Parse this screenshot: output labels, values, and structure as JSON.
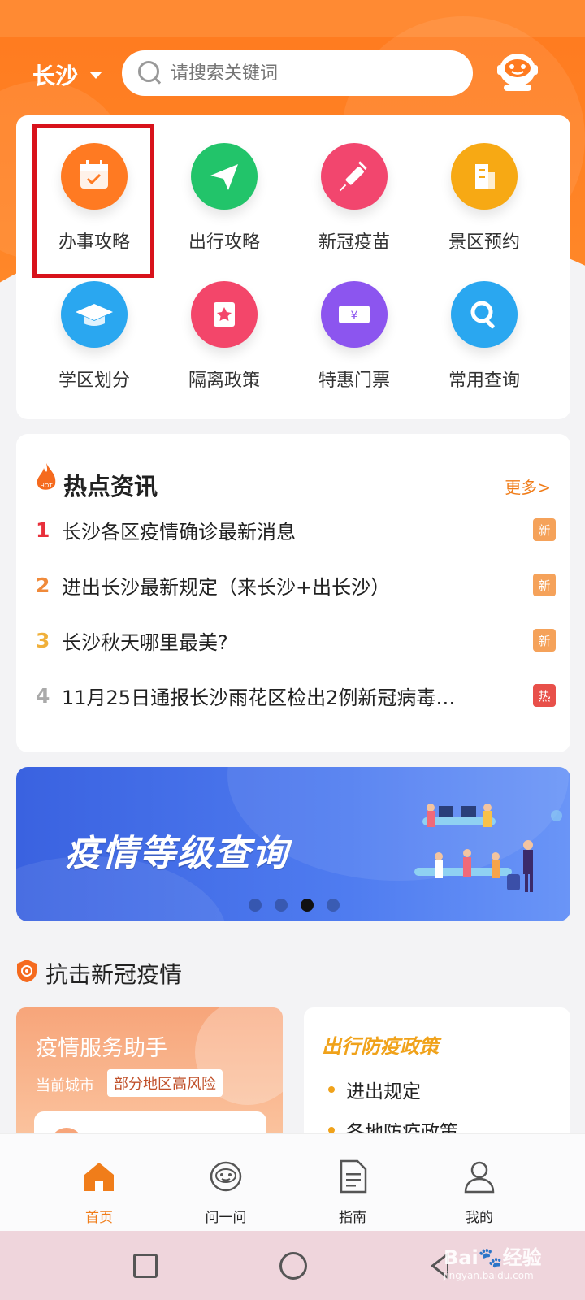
{
  "header": {
    "city": "长沙",
    "search_placeholder": "请搜索关键词"
  },
  "services": [
    {
      "label": "办事攻略",
      "icon": "calendar-icon",
      "color": "#ff7a22"
    },
    {
      "label": "出行攻略",
      "icon": "paper-plane-icon",
      "color": "#22c46a"
    },
    {
      "label": "新冠疫苗",
      "icon": "syringe-icon",
      "color": "#f2466e"
    },
    {
      "label": "景区预约",
      "icon": "building-icon",
      "color": "#f7a914"
    },
    {
      "label": "学区划分",
      "icon": "graduation-cap-icon",
      "color": "#2aa7f0"
    },
    {
      "label": "隔离政策",
      "icon": "badge-icon",
      "color": "#f3466a"
    },
    {
      "label": "特惠门票",
      "icon": "ticket-icon",
      "color": "#8c55ef"
    },
    {
      "label": "常用查询",
      "icon": "search-icon",
      "color": "#2aa7f0"
    }
  ],
  "news": {
    "title": "热点资讯",
    "more": "更多>",
    "items": [
      {
        "rank": "1",
        "text": "长沙各区疫情确诊最新消息",
        "badge": "新"
      },
      {
        "rank": "2",
        "text": "进出长沙最新规定（来长沙+出长沙）",
        "badge": "新"
      },
      {
        "rank": "3",
        "text": "长沙秋天哪里最美?",
        "badge": "新"
      },
      {
        "rank": "4",
        "text": "11月25日通报长沙雨花区检出2例新冠病毒…",
        "badge": "热"
      }
    ]
  },
  "banner": {
    "title": "疫情等级查询"
  },
  "covid": {
    "section_title": "抗击新冠疫情",
    "left_title": "疫情服务助手",
    "left_city_label": "当前城市",
    "left_risk": "部分地区高风险",
    "right_title": "出行防疫政策",
    "right_items": [
      "进出规定",
      "各地防疫政策"
    ]
  },
  "tabs": [
    {
      "label": "首页",
      "icon": "home-icon"
    },
    {
      "label": "问一问",
      "icon": "robot-icon"
    },
    {
      "label": "指南",
      "icon": "document-icon"
    },
    {
      "label": "我的",
      "icon": "user-icon"
    }
  ],
  "watermark": {
    "brand": "Bai",
    "suffix": "经验",
    "url": "jingyan.baidu.com"
  }
}
